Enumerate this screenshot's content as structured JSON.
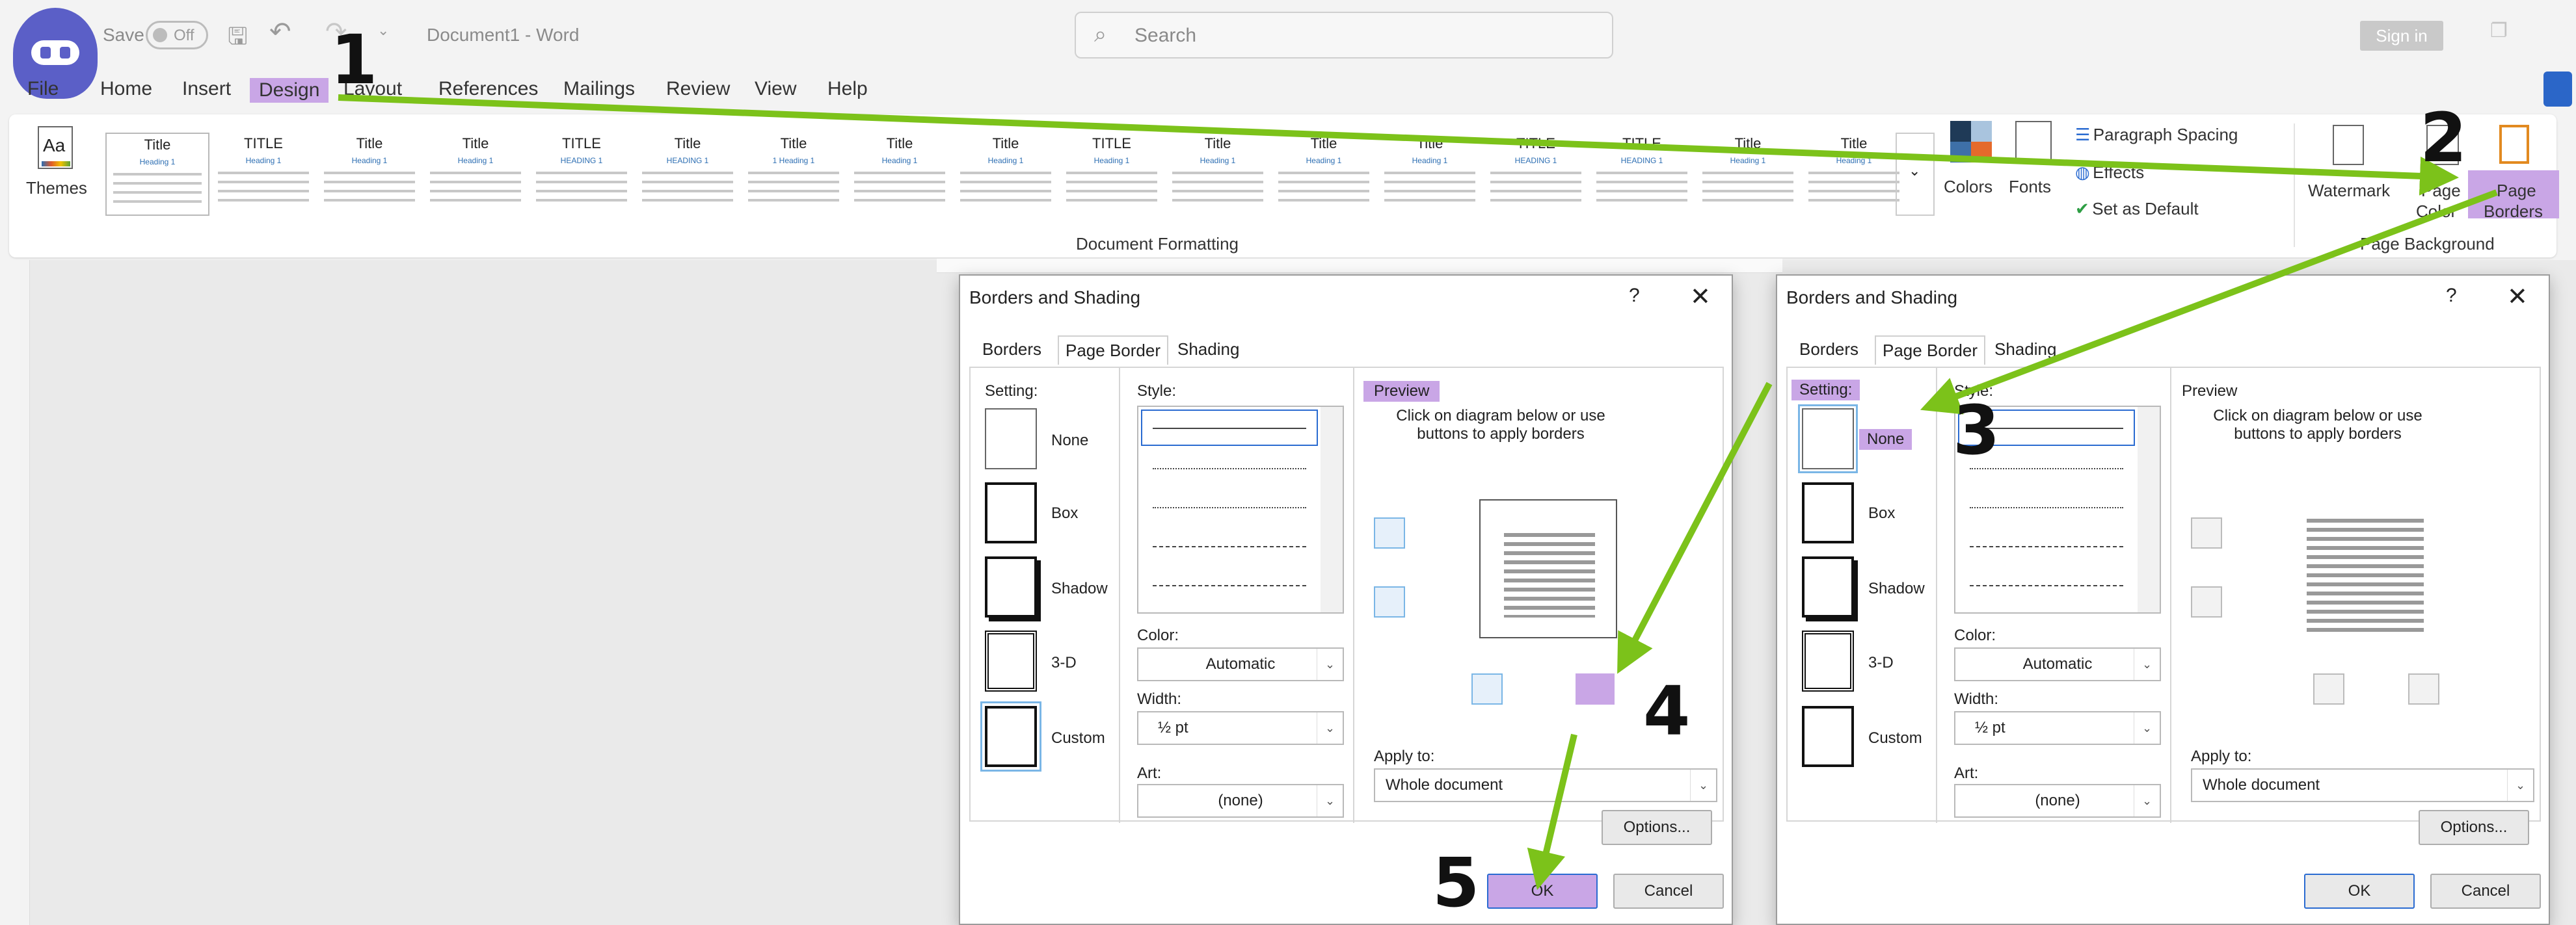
{
  "titlebar": {
    "autosave_label": "Save",
    "autosave_state": "Off",
    "doc_title": "Document1 - Word",
    "search_placeholder": "Search",
    "signin": "Sign in"
  },
  "tabs": [
    "File",
    "Home",
    "Insert",
    "Design",
    "Layout",
    "References",
    "Mailings",
    "Review",
    "View",
    "Help"
  ],
  "ribbon": {
    "themes": "Themes",
    "gallery": [
      {
        "title": "Title",
        "heading": "Heading 1"
      },
      {
        "title": "TITLE",
        "heading": "Heading 1"
      },
      {
        "title": "Title",
        "heading": "Heading 1"
      },
      {
        "title": "Title",
        "heading": "Heading 1"
      },
      {
        "title": "TITLE",
        "heading": "HEADING 1"
      },
      {
        "title": "Title",
        "heading": "HEADING 1"
      },
      {
        "title": "Title",
        "heading": "1 Heading 1"
      },
      {
        "title": "Title",
        "heading": "Heading 1"
      },
      {
        "title": "Title",
        "heading": "Heading 1"
      },
      {
        "title": "TITLE",
        "heading": "Heading 1"
      },
      {
        "title": "Title",
        "heading": "Heading 1"
      },
      {
        "title": "Title",
        "heading": "Heading 1"
      },
      {
        "title": "Title",
        "heading": "Heading 1"
      },
      {
        "title": "TITLE",
        "heading": "HEADING 1"
      },
      {
        "title": "TITLE",
        "heading": "HEADING 1"
      },
      {
        "title": "Title",
        "heading": "Heading 1"
      },
      {
        "title": "Title",
        "heading": "Heading 1"
      }
    ],
    "colors": "Colors",
    "fonts": "Fonts",
    "paragraph_spacing": "Paragraph Spacing",
    "effects": "Effects",
    "set_default": "Set as Default",
    "doc_formatting_group": "Document Formatting",
    "watermark": "Watermark",
    "page_color_1": "Page",
    "page_color_2": "Color",
    "page_borders_1": "Page",
    "page_borders_2": "Borders",
    "page_background_group": "Page Background"
  },
  "dialog_left": {
    "title": "Borders and Shading",
    "help": "?",
    "close": "✕",
    "tabs": [
      "Borders",
      "Page Border",
      "Shading"
    ],
    "setting_label": "Setting:",
    "settings": [
      "None",
      "Box",
      "Shadow",
      "3-D",
      "Custom"
    ],
    "style_label": "Style:",
    "color_label": "Color:",
    "color_value": "Automatic",
    "width_label": "Width:",
    "width_value": "½ pt",
    "art_label": "Art:",
    "art_value": "(none)",
    "preview_label": "Preview",
    "preview_hint": "Click on diagram below or use buttons to apply borders",
    "apply_label": "Apply to:",
    "apply_value": "Whole document",
    "options": "Options...",
    "ok": "OK",
    "cancel": "Cancel"
  },
  "dialog_right": {
    "title": "Borders and Shading",
    "help": "?",
    "close": "✕",
    "tabs": [
      "Borders",
      "Page Border",
      "Shading"
    ],
    "setting_label": "Setting:",
    "settings": [
      "None",
      "Box",
      "Shadow",
      "3-D",
      "Custom"
    ],
    "style_label": "Style:",
    "color_label": "Color:",
    "color_value": "Automatic",
    "width_label": "Width:",
    "width_value": "½ pt",
    "art_label": "Art:",
    "art_value": "(none)",
    "preview_label": "Preview",
    "preview_hint": "Click on diagram below or use buttons to apply borders",
    "apply_label": "Apply to:",
    "apply_value": "Whole document",
    "options": "Options...",
    "ok": "OK",
    "cancel": "Cancel"
  },
  "step_numbers": [
    "1",
    "2",
    "3",
    "4",
    "5"
  ],
  "colors": {
    "highlight": "#c9a6e6",
    "arrow": "#7cc21a"
  }
}
